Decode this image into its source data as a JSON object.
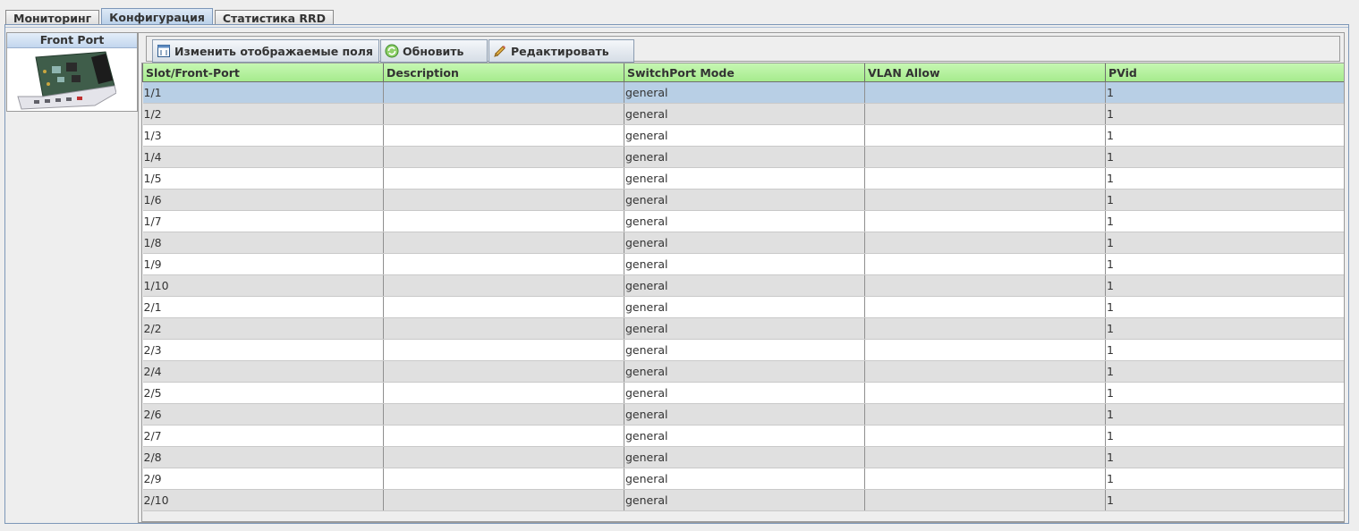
{
  "tabs": [
    {
      "label": "Мониторинг",
      "active": false
    },
    {
      "label": "Конфигурация",
      "active": true
    },
    {
      "label": "Статистика RRD",
      "active": false
    }
  ],
  "device": {
    "title": "Front Port",
    "image": "network-module-board"
  },
  "toolbar": {
    "change_fields_label": "Изменить отображаемые поля",
    "refresh_label": "Обновить",
    "edit_label": "Редактировать"
  },
  "table": {
    "columns": [
      "Slot/Front-Port",
      "Description",
      "SwitchPort Mode",
      "VLAN Allow",
      "PVid"
    ],
    "rows": [
      [
        "1/1",
        "",
        "general",
        "",
        "1"
      ],
      [
        "1/2",
        "",
        "general",
        "",
        "1"
      ],
      [
        "1/3",
        "",
        "general",
        "",
        "1"
      ],
      [
        "1/4",
        "",
        "general",
        "",
        "1"
      ],
      [
        "1/5",
        "",
        "general",
        "",
        "1"
      ],
      [
        "1/6",
        "",
        "general",
        "",
        "1"
      ],
      [
        "1/7",
        "",
        "general",
        "",
        "1"
      ],
      [
        "1/8",
        "",
        "general",
        "",
        "1"
      ],
      [
        "1/9",
        "",
        "general",
        "",
        "1"
      ],
      [
        "1/10",
        "",
        "general",
        "",
        "1"
      ],
      [
        "2/1",
        "",
        "general",
        "",
        "1"
      ],
      [
        "2/2",
        "",
        "general",
        "",
        "1"
      ],
      [
        "2/3",
        "",
        "general",
        "",
        "1"
      ],
      [
        "2/4",
        "",
        "general",
        "",
        "1"
      ],
      [
        "2/5",
        "",
        "general",
        "",
        "1"
      ],
      [
        "2/6",
        "",
        "general",
        "",
        "1"
      ],
      [
        "2/7",
        "",
        "general",
        "",
        "1"
      ],
      [
        "2/8",
        "",
        "general",
        "",
        "1"
      ],
      [
        "2/9",
        "",
        "general",
        "",
        "1"
      ],
      [
        "2/10",
        "",
        "general",
        "",
        "1"
      ]
    ],
    "selected_row": 0
  },
  "colors": {
    "header_bg": "#a6eb8d",
    "selected_row": "#b8cfe5",
    "tab_active": "#b8cfe8"
  }
}
